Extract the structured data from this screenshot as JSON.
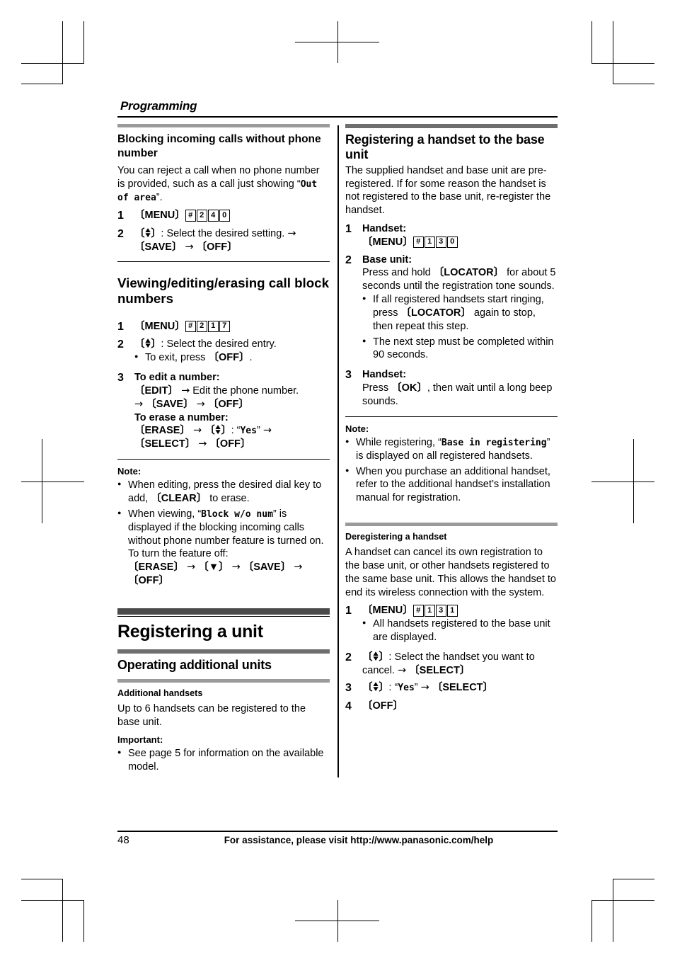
{
  "chapter": {
    "title": "Programming"
  },
  "footer": {
    "page_number": "48",
    "assistance_text": "For assistance, please visit http://www.panasonic.com/help"
  },
  "left_column": {
    "block_no_number": {
      "heading": "Blocking incoming calls without phone number",
      "intro_a": "You can reject a call when no phone number is provided, such as a call just showing “",
      "intro_display": "Out of area",
      "intro_b": "”.",
      "step1_num": "1",
      "step1_key": "MENU",
      "step1_codes": [
        "#",
        "2",
        "4",
        "0"
      ],
      "step2_num": "2",
      "step2_text": ": Select the desired setting.",
      "step2_keys": [
        "SAVE",
        "OFF"
      ]
    },
    "view_edit_erase": {
      "heading": "Viewing/editing/erasing call block numbers",
      "step1_num": "1",
      "step1_key": "MENU",
      "step1_codes": [
        "#",
        "2",
        "1",
        "7"
      ],
      "step2_num": "2",
      "step2_text": ": Select the desired entry.",
      "step2_bullet_a": "To exit, press ",
      "step2_bullet_key": "OFF",
      "step2_bullet_b": ".",
      "step3_num": "3",
      "step3_edit_label": "To edit a number:",
      "step3_edit_key1": "EDIT",
      "step3_edit_mid": "Edit the phone number.",
      "step3_edit_key2": "SAVE",
      "step3_edit_key3": "OFF",
      "step3_erase_label": "To erase a number:",
      "step3_erase_key1": "ERASE",
      "step3_erase_yes": "Yes",
      "step3_erase_key2": "SELECT",
      "step3_erase_key3": "OFF"
    },
    "note": {
      "label": "Note:",
      "bullet1_a": "When editing, press the desired dial key to add, ",
      "bullet1_key": "CLEAR",
      "bullet1_b": " to erase.",
      "bullet2_a": "When viewing, “",
      "bullet2_display": "Block w/o num",
      "bullet2_b": "” is displayed if the blocking incoming calls without phone number feature is turned on. To turn the feature off:",
      "bullet2_key1": "ERASE",
      "bullet2_key2": "▼",
      "bullet2_key3": "SAVE",
      "bullet2_key4": "OFF"
    },
    "registering_unit": {
      "chapter_heading": "Registering a unit",
      "section_heading": "Operating additional units",
      "sub_heading": "Additional handsets",
      "body": "Up to 6 handsets can be registered to the base unit.",
      "important_label": "Important:",
      "important_bullet": "See page 5 for information on the available model."
    }
  },
  "right_column": {
    "registering_handset": {
      "heading": "Registering a handset to the base unit",
      "intro": "The supplied handset and base unit are pre-registered. If for some reason the handset is not registered to the base unit, re-register the handset.",
      "step1_num": "1",
      "step1_label": "Handset:",
      "step1_key": "MENU",
      "step1_codes": [
        "#",
        "1",
        "3",
        "0"
      ],
      "step2_num": "2",
      "step2_label": "Base unit:",
      "step2_text_a": "Press and hold ",
      "step2_key": "LOCATOR",
      "step2_text_b": " for about 5 seconds until the registration tone sounds.",
      "step2_bullet1_a": "If all registered handsets start ringing, press ",
      "step2_bullet1_key": "LOCATOR",
      "step2_bullet1_b": " again to stop, then repeat this step.",
      "step2_bullet2": "The next step must be completed within 90 seconds.",
      "step3_num": "3",
      "step3_label": "Handset:",
      "step3_text_a": "Press ",
      "step3_key": "OK",
      "step3_text_b": ", then wait until a long beep sounds."
    },
    "note": {
      "label": "Note:",
      "bullet1_a": "While registering, “",
      "bullet1_display": "Base in registering",
      "bullet1_b": "” is displayed on all registered handsets.",
      "bullet2": "When you purchase an additional handset, refer to the additional handset’s installation manual for registration."
    },
    "deregistering": {
      "heading": "Deregistering a handset",
      "body": "A handset can cancel its own registration to the base unit, or other handsets registered to the same base unit. This allows the handset to end its wireless connection with the system.",
      "step1_num": "1",
      "step1_key": "MENU",
      "step1_codes": [
        "#",
        "1",
        "3",
        "1"
      ],
      "step1_bullet": "All handsets registered to the base unit are displayed.",
      "step2_num": "2",
      "step2_text": ": Select the handset you want to cancel.",
      "step2_key": "SELECT",
      "step3_num": "3",
      "step3_yes": "Yes",
      "step3_key": "SELECT",
      "step4_num": "4",
      "step4_key": "OFF"
    }
  },
  "colors": {
    "chapter_bar": "#4b4b4b",
    "section_bar": "#6e6e6e",
    "sub_bar": "#9a9a9a",
    "text": "#000000",
    "background": "#ffffff"
  }
}
